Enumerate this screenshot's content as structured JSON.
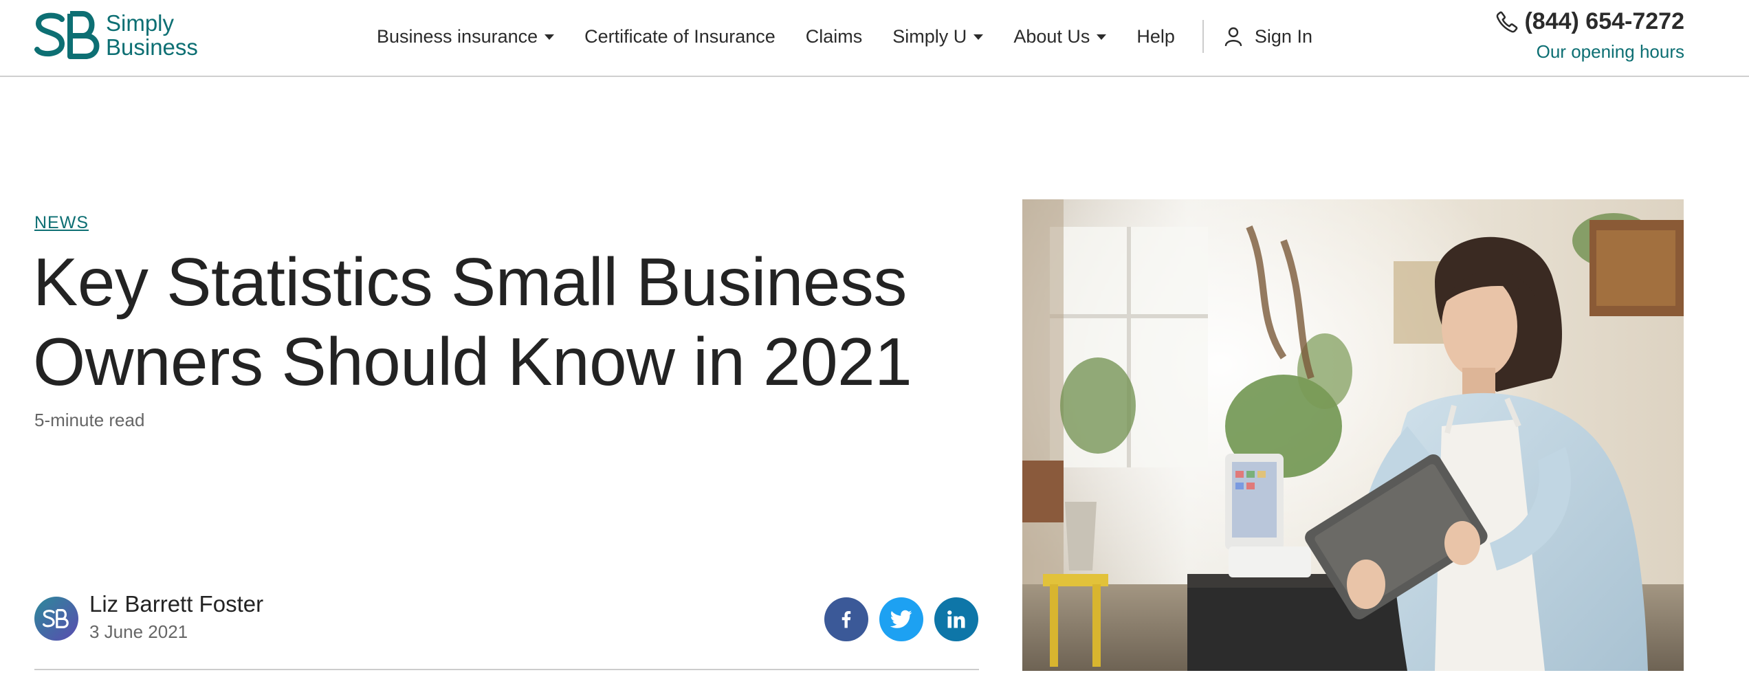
{
  "brand": {
    "name_line1": "Simply",
    "name_line2": "Business",
    "color": "#0d6f73"
  },
  "nav": {
    "items": [
      {
        "label": "Business insurance",
        "has_dropdown": true
      },
      {
        "label": "Certificate of Insurance",
        "has_dropdown": false
      },
      {
        "label": "Claims",
        "has_dropdown": false
      },
      {
        "label": "Simply U",
        "has_dropdown": true
      },
      {
        "label": "About Us",
        "has_dropdown": true
      },
      {
        "label": "Help",
        "has_dropdown": false
      }
    ],
    "sign_in": "Sign In"
  },
  "contact": {
    "phone": "(844) 654-7272",
    "hours_link": "Our opening hours"
  },
  "article": {
    "category": "NEWS",
    "title": "Key Statistics Small Business Owners Should Know in 2021",
    "read_time": "5-minute read",
    "author": {
      "name": "Liz Barrett Foster",
      "date": "3 June 2021",
      "avatar_initials": "SB"
    },
    "share": [
      {
        "network": "facebook",
        "icon": "facebook-icon",
        "color": "#3b5998"
      },
      {
        "network": "twitter",
        "icon": "twitter-icon",
        "color": "#1da1f2"
      },
      {
        "network": "linkedin",
        "icon": "linkedin-icon",
        "color": "#0e76a8"
      }
    ],
    "hero_image": "woman-using-tablet-in-shop"
  }
}
